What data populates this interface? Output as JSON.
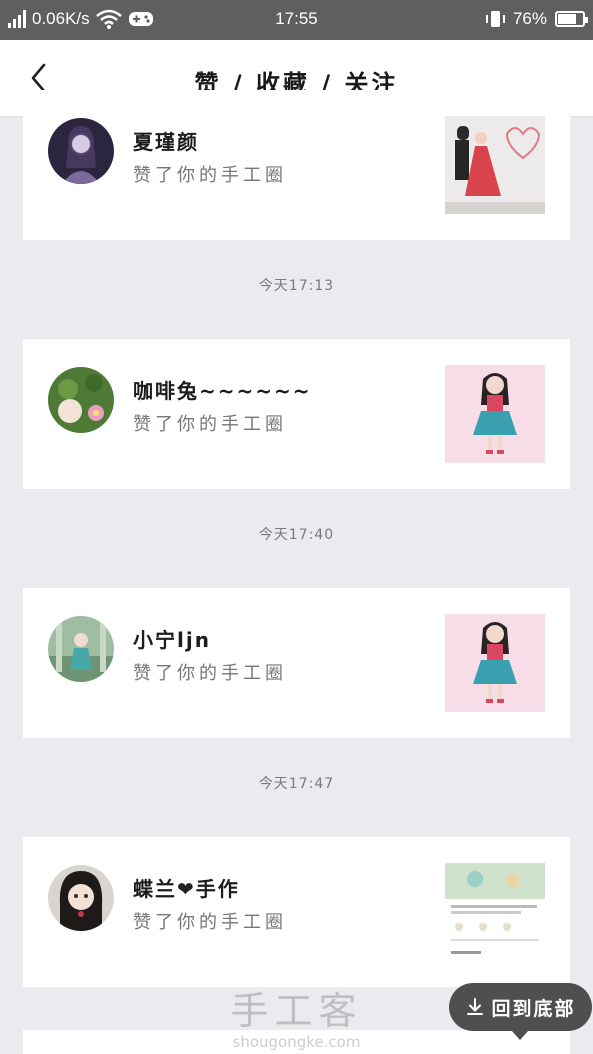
{
  "status_bar": {
    "speed": "0.06K/s",
    "time": "17:55",
    "battery": "76%",
    "battery_level": 0.76
  },
  "nav": {
    "title": "赞 / 收藏 / 关注",
    "back_icon": "chevron-left-icon"
  },
  "items": [
    {
      "name": "夏瑾颜",
      "action": "赞了你的手工圈",
      "timestamp": "今天17:13"
    },
    {
      "name": "咖啡兔~~~~~~",
      "action": "赞了你的手工圈",
      "timestamp": "今天17:40"
    },
    {
      "name": "小宁ljn",
      "action": "赞了你的手工圈",
      "timestamp": "今天17:47"
    },
    {
      "name_part1": "蝶兰",
      "name_part2": "手作",
      "action": "赞了你的手工圈"
    }
  ],
  "watermark": {
    "text": "手工客",
    "url": "shougongke.com"
  },
  "to_bottom": {
    "label": "回到底部",
    "icon": "download-icon"
  },
  "colors": {
    "status_bar": "#5f5f5f",
    "background": "#ebebef",
    "button": "#4f4f4f"
  }
}
